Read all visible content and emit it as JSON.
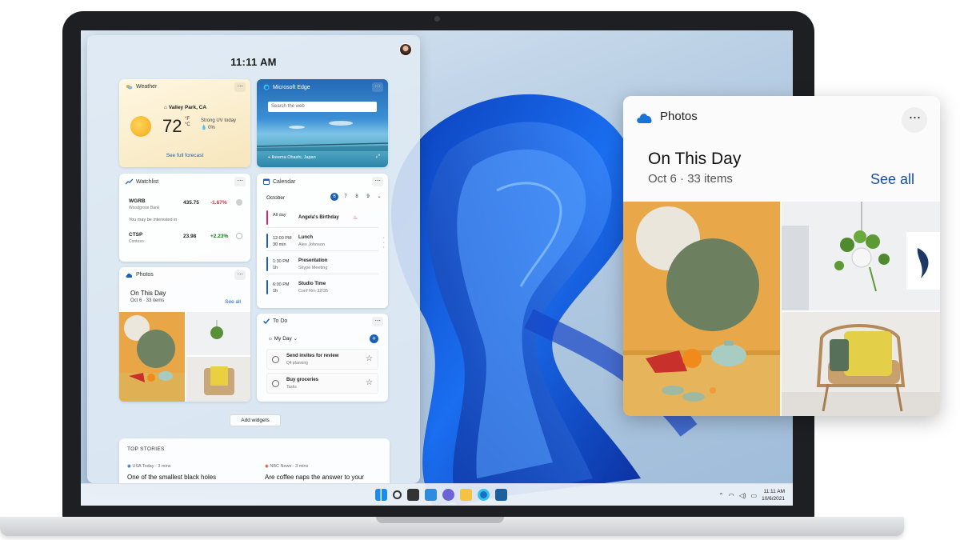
{
  "widgets": {
    "clock": "11:11 AM",
    "weather": {
      "title": "Weather",
      "location": "Valley Park, CA",
      "temperature": "72",
      "units": "°F",
      "alt_units": "°C",
      "condition": "Strong UV today",
      "precip": "0%",
      "link": "See full forecast"
    },
    "edge": {
      "title": "Microsoft Edge",
      "search_placeholder": "Search the web",
      "caption": "Ikeema Ohashi, Japan"
    },
    "watchlist": {
      "title": "Watchlist",
      "stocks": [
        {
          "symbol": "WGRB",
          "company": "Woodgrove Bank",
          "price": "435.75",
          "change": "-1.67%"
        },
        {
          "symbol": "CTSP",
          "company": "Contoso",
          "price": "23.98",
          "change": "+2.23%"
        }
      ],
      "interest_label": "You may be interested in"
    },
    "calendar": {
      "title": "Calendar",
      "month": "October",
      "days": [
        "6",
        "7",
        "8",
        "9"
      ],
      "events": [
        {
          "time": "All day",
          "time2": "",
          "title": "Angela's Birthday",
          "sub": "",
          "color": "#d6246e"
        },
        {
          "time": "12:00 PM",
          "time2": "30 min",
          "title": "Lunch",
          "sub": "Alex Johnson",
          "color": "#1a5fb4"
        },
        {
          "time": "1:30 PM",
          "time2": "1h",
          "title": "Presentation",
          "sub": "Skype Meeting",
          "color": "#1a5fb4"
        },
        {
          "time": "6:00 PM",
          "time2": "1h",
          "title": "Studio Time",
          "sub": "Conf Rm 32/35",
          "color": "#1a5fb4"
        }
      ]
    },
    "photos": {
      "title": "Photos",
      "heading": "On This Day",
      "sub": "Oct 6 · 33 items",
      "see_all": "See all"
    },
    "todo": {
      "title": "To Do",
      "list": "My Day",
      "tasks": [
        {
          "title": "Send invites for review",
          "sub": "Q4 planning"
        },
        {
          "title": "Buy groceries",
          "sub": "Tasks"
        }
      ]
    },
    "add_widgets": "Add widgets",
    "top_stories": {
      "heading": "TOP STORIES",
      "items": [
        {
          "source": "USA Today · 3 mins",
          "title": "One of the smallest black holes"
        },
        {
          "source": "NBC News · 3 mins",
          "title": "Are coffee naps the answer to your"
        }
      ]
    }
  },
  "taskbar": {
    "time": "11:11 AM",
    "date": "10/6/2021"
  },
  "photos_card": {
    "app": "Photos",
    "heading": "On This Day",
    "date": "Oct 6",
    "count": "· 33 items",
    "see_all": "See all"
  },
  "colors": {
    "accent": "#1a5fb4",
    "negative": "#d13438",
    "positive": "#107c10"
  }
}
